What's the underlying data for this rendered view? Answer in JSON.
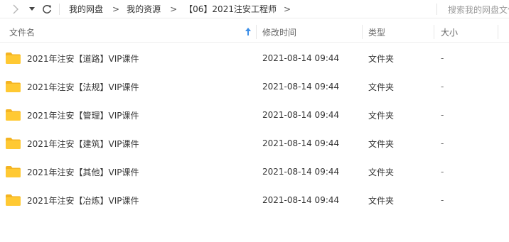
{
  "toolbar": {
    "search_placeholder": "搜索我的网盘文件"
  },
  "breadcrumb": {
    "items": [
      "我的网盘",
      "我的资源",
      "【06】2021注安工程师"
    ],
    "separator": ">"
  },
  "header": {
    "name": "文件名",
    "modified": "修改时间",
    "type": "类型",
    "size": "大小"
  },
  "files": [
    {
      "name": "2021年注安【道路】VIP课件",
      "modified": "2021-08-14 09:44",
      "type": "文件夹",
      "size": "-"
    },
    {
      "name": "2021年注安【法规】VIP课件",
      "modified": "2021-08-14 09:44",
      "type": "文件夹",
      "size": "-"
    },
    {
      "name": "2021年注安【管理】VIP课件",
      "modified": "2021-08-14 09:44",
      "type": "文件夹",
      "size": "-"
    },
    {
      "name": "2021年注安【建筑】VIP课件",
      "modified": "2021-08-14 09:44",
      "type": "文件夹",
      "size": "-"
    },
    {
      "name": "2021年注安【其他】VIP课件",
      "modified": "2021-08-14 09:44",
      "type": "文件夹",
      "size": "-"
    },
    {
      "name": "2021年注安【冶炼】VIP课件",
      "modified": "2021-08-14 09:44",
      "type": "文件夹",
      "size": "-"
    }
  ],
  "colors": {
    "folder": "#ffc933",
    "folder_tab": "#f4b422",
    "sort_arrow": "#3b8ee8",
    "text": "#333333",
    "muted": "#999999"
  },
  "icons": {
    "forward": "chevron-right-icon",
    "dropdown": "caret-down-icon",
    "refresh": "refresh-icon",
    "sort": "sort-ascending-icon",
    "folder": "folder-icon"
  }
}
